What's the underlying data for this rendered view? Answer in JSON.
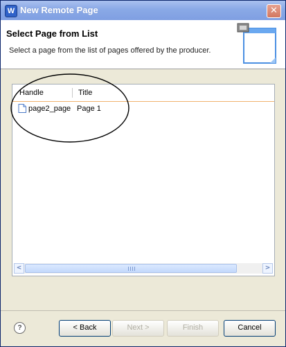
{
  "window": {
    "title": "New Remote Page",
    "icon": "wizard-app-icon",
    "close_glyph": "✕"
  },
  "banner": {
    "title": "Select Page from List",
    "description": "Select a page from the list of pages offered by the producer."
  },
  "table": {
    "columns": [
      "Handle",
      "Title"
    ],
    "rows": [
      {
        "handle": "page2_page",
        "title": "Page 1",
        "icon": "page-file-icon"
      }
    ],
    "scrollbar": {
      "left_arrow": "<",
      "right_arrow": ">"
    }
  },
  "buttons": {
    "help": "?",
    "back": "< Back",
    "next": "Next >",
    "finish": "Finish",
    "cancel": "Cancel"
  },
  "colors": {
    "titlebar": "#8aa9e6",
    "accent_header_line": "#f1b26d",
    "annotation": "#000000"
  }
}
